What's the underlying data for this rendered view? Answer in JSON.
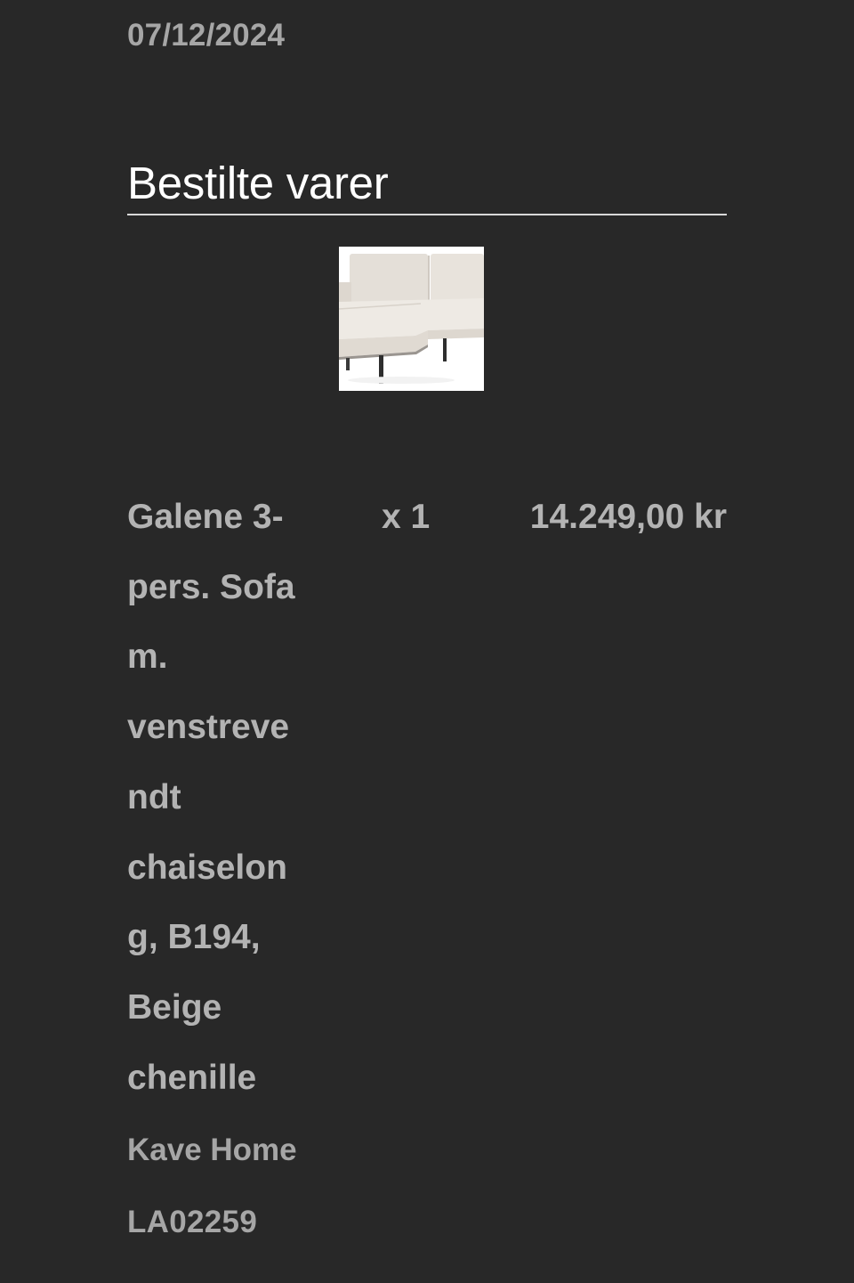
{
  "order": {
    "date": "07/12/2024"
  },
  "section": {
    "title": "Bestilte varer"
  },
  "item": {
    "image_icon": "sofa-product-photo",
    "name": "Galene 3-\npers. Sofa\nm.\nvenstreve\nndt\nchaiselon\ng, B194,\nBeige\nchenille",
    "quantity": "x 1",
    "price": "14.249,00 kr",
    "brand": "Kave Home",
    "sku": "LA02259"
  },
  "colors": {
    "background": "#282828",
    "title_text": "#ffffff",
    "body_text": "#b3b3b3",
    "muted_text": "#a6a6a6",
    "divider": "#d9d9d9"
  }
}
